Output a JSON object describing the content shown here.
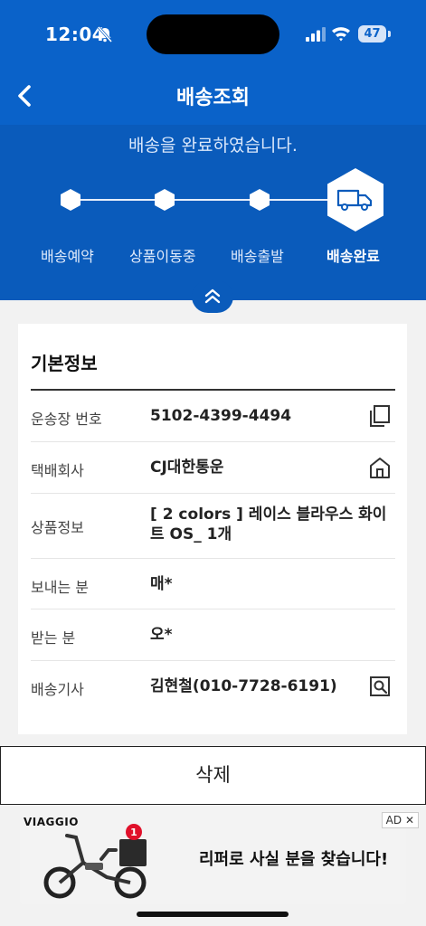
{
  "status_bar": {
    "time": "12:04",
    "battery": "47"
  },
  "header": {
    "title": "배송조회"
  },
  "progress": {
    "message": "배송을 완료하였습니다.",
    "steps": [
      "배송예약",
      "상품이동중",
      "배송출발",
      "배송완료"
    ],
    "current_step": 4
  },
  "basic_info": {
    "title": "기본정보",
    "rows": [
      {
        "label": "운송장 번호",
        "value": "5102-4399-4494",
        "action_icon": "copy-icon"
      },
      {
        "label": "택배회사",
        "value": "CJ대한통운",
        "action_icon": "home-icon"
      },
      {
        "label": "상품정보",
        "value": "[ 2 colors ] 레이스 블라우스 화이트 OS_ 1개"
      },
      {
        "label": "보내는 분",
        "value": "매*"
      },
      {
        "label": "받는 분",
        "value": "오*"
      },
      {
        "label": "배송기사",
        "value": "김현철(010-7728-6191)",
        "action_icon": "contact-search-icon"
      }
    ]
  },
  "actions": {
    "delete_label": "삭제"
  },
  "ad": {
    "brand": "VIAGGIO",
    "badge": "AD",
    "close": "✕",
    "notification_count": "1",
    "headline": "리퍼로 사실 분을 찾습니다!"
  },
  "colors": {
    "brand_blue": "#0a62c9",
    "panel_blue": "#0a5bbb",
    "ad_badge_red": "#e0102a"
  }
}
